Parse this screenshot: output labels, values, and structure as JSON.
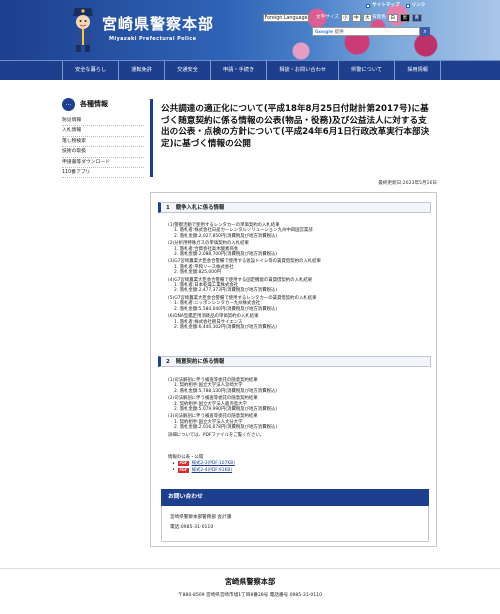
{
  "header": {
    "title": "宮崎県警察本部",
    "subtitle": "Miyazaki Prefectural Police",
    "top_links": [
      "サイトマップ",
      "リンク"
    ],
    "language_button": "Foreign Language",
    "font_size_label": "文字サイズ",
    "font_sizes": [
      "小",
      "中",
      "大"
    ],
    "bg_color_label": "背景色",
    "bg_colors": [
      "白",
      "黒",
      "青"
    ],
    "search_placeholder": "Google 提供",
    "search_button_icon": "magnifier-icon"
  },
  "nav": {
    "items": [
      "安全な暮らし",
      "運転免許",
      "交通安全",
      "申請・手続き",
      "相談・お問い合わせ",
      "県警について",
      "採用情報"
    ]
  },
  "sidebar": {
    "heading": "各種情報",
    "heading_icon": "…",
    "items": [
      "防災情報",
      "入札情報",
      "落し物検索",
      "技術の取扱",
      "申請書等ダウンロード",
      "110番アプリ"
    ]
  },
  "main": {
    "title": "公共調達の適正化について(平成18年8月25日付財計第2017号)に基づく随意契約に係る情報の公表(物品・役務)及び公益法人に対する支出の公表・点検の方針について(平成24年6月1日行政改革実行本部決定)に基づく情報の公開",
    "updated": "最終更新日:2023年5月16日",
    "section1": {
      "num": "1",
      "title": "競争入札に係る情報",
      "lines": [
        "(1)警察活動で使用するレンタカーの単価契約の入札結果",
        "1. 落札者:株式会社日産カーレンタルソリューション九州中四国営業部",
        "2. 落札金額:2,027,850円(消費税及び地方消費税込)",
        "(2)分析用特殊ガスの単価契約の入札結果",
        "1. 落札者:合資会社高木酸素商会",
        "2. 落札金額:2,088,700円(消費税及び地方消費税込)",
        "(3)G7宮崎農業大臣会合警備で使用する仮設トイレ等の賃貸借契約の入札結果",
        "1. 落札者:平和リース株式会社",
        "2. 落札金額:825,000円",
        "(4)G7宮崎農業大臣会合警備で使用する固定機能の賃貸借契約の入札結果",
        "1. 落札者:日本乾燥工業株式会社",
        "2. 落札金額:2,477,373円(消費税及び地方消費税込)",
        "(5)G7宮崎農業大臣会合警備で使用するレンタカーの賃貸借契約の入札結果",
        "1. 落札者:ニッポンレンタカー九州株式会社",
        "2. 落札金額:5,584,040円(消費税及び地方消費税込)",
        "(6)DNA型鑑定用消耗品の単価契約の入札結果",
        "1. 落札者:株式会社朝日サイエンス",
        "2. 落札金額:6,440,302円(消費税及び地方消費税込)"
      ]
    },
    "section2": {
      "num": "2",
      "title": "随意契約に係る情報",
      "lines": [
        "(1)司法解剖に伴う検査等委託の随意契約結果",
        "1. 契約相手:国立大学法人宮崎大学",
        "2. 落札金額:5,788,130円(消費税及び地方消費税込)",
        "(2)司法解剖に伴う検査等委託の随意契約結果",
        "1. 契約相手:国立大学法人鹿児島大学",
        "2. 落札金額:5,079,990円(消費税及び地方消費税込)",
        "(3)司法解剖に伴う検査等委託の随意契約結果",
        "1. 契約相手:国立大学法人大分大学",
        "2. 落札金額:2,016,678円(消費税及び地方消費税込)"
      ],
      "note": "詳細については、PDFファイルをご覧ください。"
    },
    "pdf": {
      "heading": "情報の公表・公開",
      "badge": "PDF",
      "links": [
        "様式2-3(PDF:107KB)",
        "様式2-4(PDF:91KB)"
      ]
    },
    "contact": {
      "heading": "お問い合わせ",
      "org": "宮崎県警察本部警務部 会計課",
      "phone": "電話:0985-31-0110"
    }
  },
  "footer": {
    "title": "宮崎県警察本部",
    "address": "〒880-8509 宮崎県宮崎市旭1丁目8番28号 電話番号 0985-31-0110"
  }
}
